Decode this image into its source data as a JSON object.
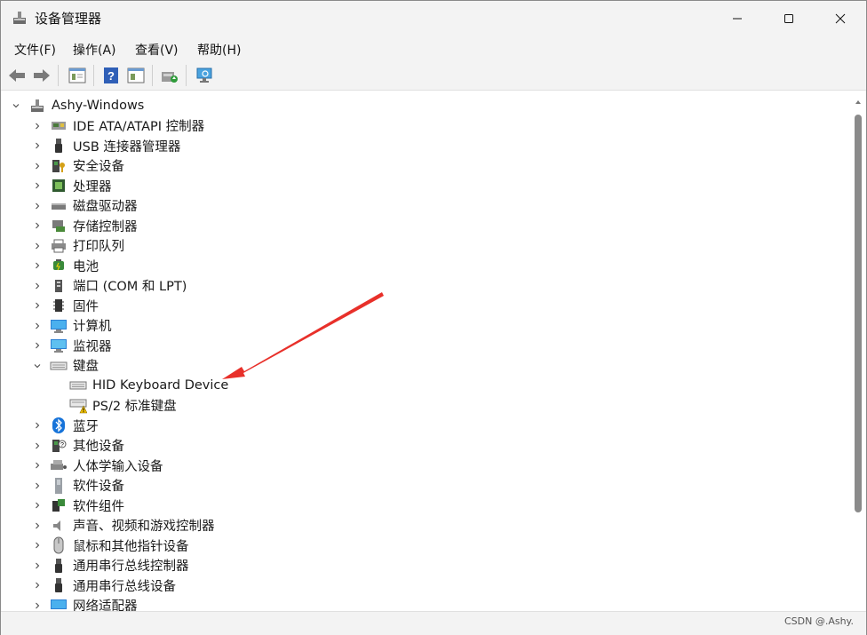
{
  "window": {
    "title": "设备管理器"
  },
  "menu": [
    "文件(F)",
    "操作(A)",
    "查看(V)",
    "帮助(H)"
  ],
  "toolbar_icons": [
    "back-arrow-icon",
    "forward-arrow-icon",
    "properties-icon",
    "help-icon",
    "view-icon",
    "update-driver-icon",
    "scan-hardware-icon"
  ],
  "tree": {
    "root": "Ashy-Windows",
    "items": [
      {
        "label": "IDE ATA/ATAPI 控制器",
        "icon": "ide-controller-icon",
        "expanded": false
      },
      {
        "label": "USB 连接器管理器",
        "icon": "usb-icon",
        "expanded": false
      },
      {
        "label": "安全设备",
        "icon": "security-device-icon",
        "expanded": false
      },
      {
        "label": "处理器",
        "icon": "processor-icon",
        "expanded": false
      },
      {
        "label": "磁盘驱动器",
        "icon": "disk-drive-icon",
        "expanded": false
      },
      {
        "label": "存储控制器",
        "icon": "storage-controller-icon",
        "expanded": false
      },
      {
        "label": "打印队列",
        "icon": "printer-icon",
        "expanded": false
      },
      {
        "label": "电池",
        "icon": "battery-icon",
        "expanded": false
      },
      {
        "label": "端口 (COM 和 LPT)",
        "icon": "port-icon",
        "expanded": false
      },
      {
        "label": "固件",
        "icon": "firmware-icon",
        "expanded": false
      },
      {
        "label": "计算机",
        "icon": "computer-icon",
        "expanded": false
      },
      {
        "label": "监视器",
        "icon": "monitor-icon",
        "expanded": false
      },
      {
        "label": "键盘",
        "icon": "keyboard-icon",
        "expanded": true,
        "children": [
          {
            "label": "HID Keyboard Device",
            "icon": "keyboard-icon"
          },
          {
            "label": "PS/2 标准键盘",
            "icon": "keyboard-warning-icon"
          }
        ]
      },
      {
        "label": "蓝牙",
        "icon": "bluetooth-icon",
        "expanded": false
      },
      {
        "label": "其他设备",
        "icon": "other-device-icon",
        "expanded": false
      },
      {
        "label": "人体学输入设备",
        "icon": "hid-icon",
        "expanded": false
      },
      {
        "label": "软件设备",
        "icon": "software-device-icon",
        "expanded": false
      },
      {
        "label": "软件组件",
        "icon": "software-component-icon",
        "expanded": false
      },
      {
        "label": "声音、视频和游戏控制器",
        "icon": "sound-icon",
        "expanded": false
      },
      {
        "label": "鼠标和其他指针设备",
        "icon": "mouse-icon",
        "expanded": false
      },
      {
        "label": "通用串行总线控制器",
        "icon": "usb-controller-icon",
        "expanded": false
      },
      {
        "label": "通用串行总线设备",
        "icon": "usb-device-icon",
        "expanded": false
      },
      {
        "label": "网络适配器",
        "icon": "network-adapter-icon",
        "expanded": false
      }
    ]
  },
  "watermark": "CSDN @.Ashy.",
  "colors": {
    "arrow": "#e8302a",
    "accent": "#0078d4"
  }
}
